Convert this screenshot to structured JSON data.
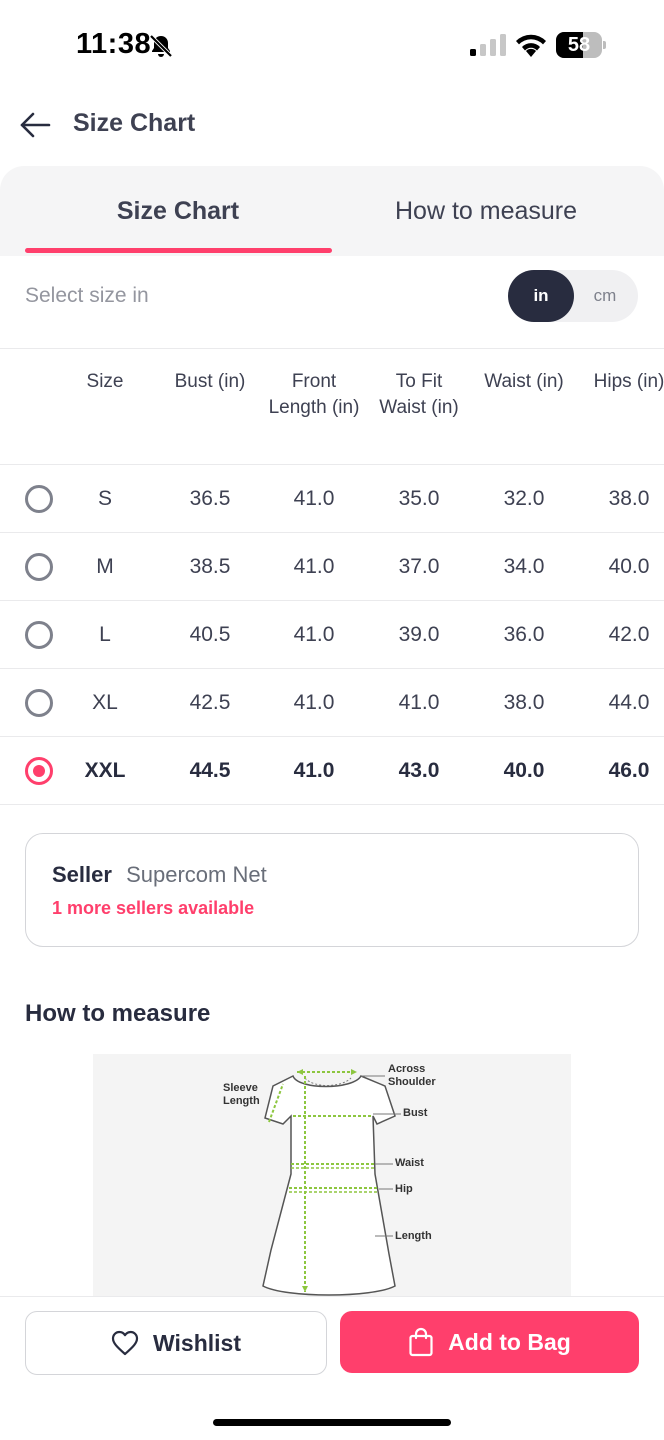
{
  "status_bar": {
    "time": "11:38",
    "battery": "58",
    "battery_level": 0.58
  },
  "header": {
    "title": "Size Chart"
  },
  "tabs": [
    {
      "label": "Size Chart",
      "active": true
    },
    {
      "label": "How to measure",
      "active": false
    }
  ],
  "unit_selector": {
    "label": "Select size in",
    "options": [
      "in",
      "cm"
    ],
    "selected": "in"
  },
  "size_table": {
    "columns": [
      "Size",
      "Bust (in)",
      "Front\nLength (in)",
      "To Fit\nWaist (in)",
      "Waist (in)",
      "Hips (in)"
    ],
    "rows": [
      {
        "size": "S",
        "bust": "36.5",
        "front_length": "41.0",
        "to_fit_waist": "35.0",
        "waist": "32.0",
        "hips": "38.0",
        "selected": false
      },
      {
        "size": "M",
        "bust": "38.5",
        "front_length": "41.0",
        "to_fit_waist": "37.0",
        "waist": "34.0",
        "hips": "40.0",
        "selected": false
      },
      {
        "size": "L",
        "bust": "40.5",
        "front_length": "41.0",
        "to_fit_waist": "39.0",
        "waist": "36.0",
        "hips": "42.0",
        "selected": false
      },
      {
        "size": "XL",
        "bust": "42.5",
        "front_length": "41.0",
        "to_fit_waist": "41.0",
        "waist": "38.0",
        "hips": "44.0",
        "selected": false
      },
      {
        "size": "XXL",
        "bust": "44.5",
        "front_length": "41.0",
        "to_fit_waist": "43.0",
        "waist": "40.0",
        "hips": "46.0",
        "selected": true
      }
    ]
  },
  "seller": {
    "label": "Seller",
    "name": "Supercom Net",
    "more": "1 more sellers available"
  },
  "how_to_measure": {
    "title": "How to measure",
    "labels": {
      "across_shoulder_1": "Across",
      "across_shoulder_2": "Shoulder",
      "sleeve_length_1": "Sleeve",
      "sleeve_length_2": "Length",
      "bust": "Bust",
      "waist": "Waist",
      "hip": "Hip",
      "length": "Length"
    }
  },
  "actions": {
    "wishlist_label": "Wishlist",
    "add_to_bag_label": "Add to Bag"
  },
  "colors": {
    "accent": "#ff3f6c",
    "dark": "#282c3f",
    "measure_green": "#8dc63f"
  }
}
